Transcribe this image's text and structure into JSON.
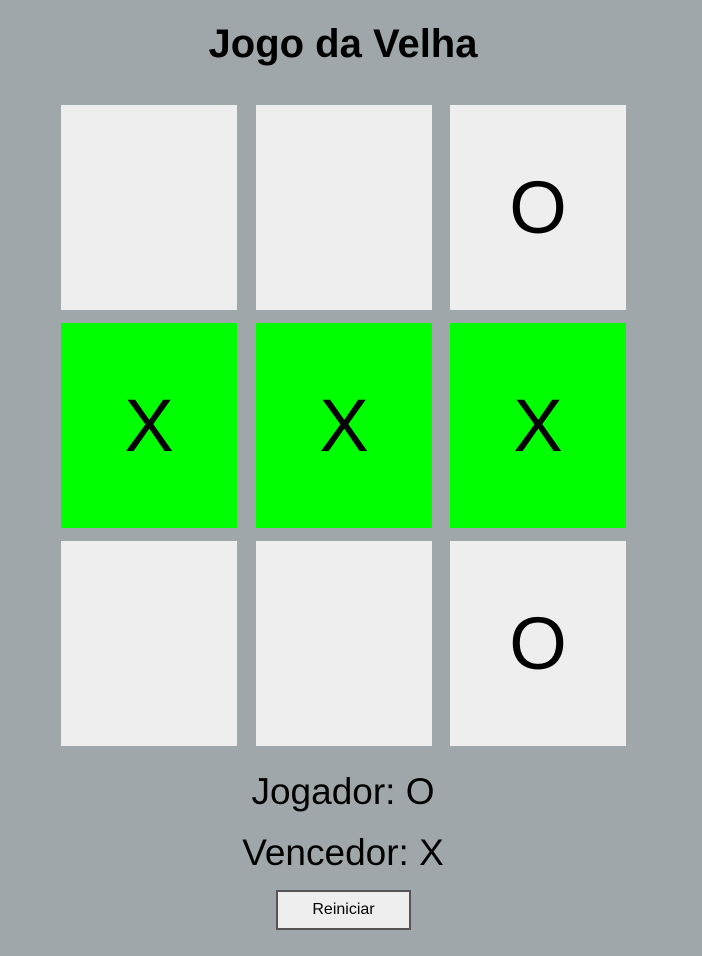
{
  "game": {
    "title": "Jogo da Velha",
    "board": [
      "",
      "",
      "O",
      "X",
      "X",
      "X",
      "",
      "",
      "O"
    ],
    "winning_cells": [
      3,
      4,
      5
    ],
    "win_color": "#00ff00",
    "cell_color": "#eeeeee",
    "background_color": "#a0a7aa",
    "current_player_text": "Jogador: O",
    "winner_text": "Vencedor: X",
    "restart_label": "Reiniciar"
  }
}
